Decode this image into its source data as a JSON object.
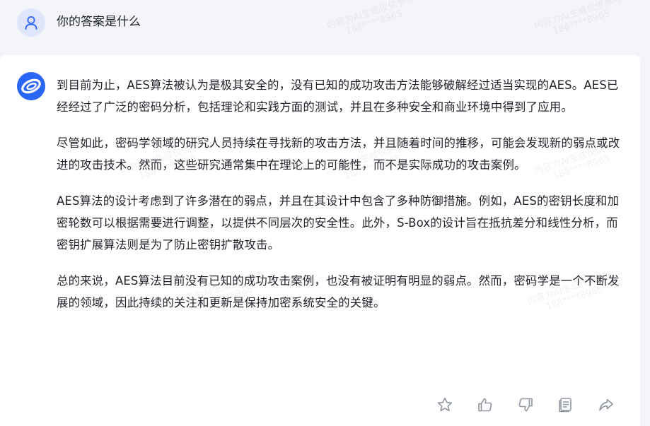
{
  "question": {
    "text": "你的答案是什么"
  },
  "answer": {
    "paragraphs": [
      "到目前为止，AES算法被认为是极其安全的，没有已知的成功攻击方法能够破解经过适当实现的AES。AES已经经过了广泛的密码分析，包括理论和实践方面的测试，并且在多种安全和商业环境中得到了应用。",
      "尽管如此，密码学领域的研究人员持续在寻找新的攻击方法，并且随着时间的推移，可能会发现新的弱点或改进的攻击技术。然而，这些研究通常集中在理论上的可能性，而不是实际成功的攻击案例。",
      "AES算法的设计考虑到了许多潜在的弱点，并且在其设计中包含了多种防御措施。例如，AES的密钥长度和加密轮数可以根据需要进行调整，以提供不同层次的安全性。此外，S-Box的设计旨在抵抗差分和线性分析，而密钥扩展算法则是为了防止密钥扩散攻击。",
      "总的来说，AES算法目前没有已知的成功攻击案例，也没有被证明有明显的弱点。然而，密码学是一个不断发展的领域，因此持续的关注和更新是保持加密系统安全的关键。"
    ]
  },
  "actions": [
    {
      "name": "favorite-star-icon"
    },
    {
      "name": "thumbs-up-icon"
    },
    {
      "name": "thumbs-down-icon"
    },
    {
      "name": "copy-icon"
    },
    {
      "name": "share-icon"
    }
  ],
  "watermark": {
    "line1": "内容为AI生成仅供参考",
    "line2": "188****8965"
  },
  "colors": {
    "page_bg": "#f4f5f8",
    "card_bg": "#ffffff",
    "user_avatar_bg": "#dfe6fb",
    "user_avatar_icon": "#3d6cf5",
    "bot_avatar_bg": "#2a66f6",
    "icon_gray": "#8f959e",
    "text": "#1f2329"
  }
}
